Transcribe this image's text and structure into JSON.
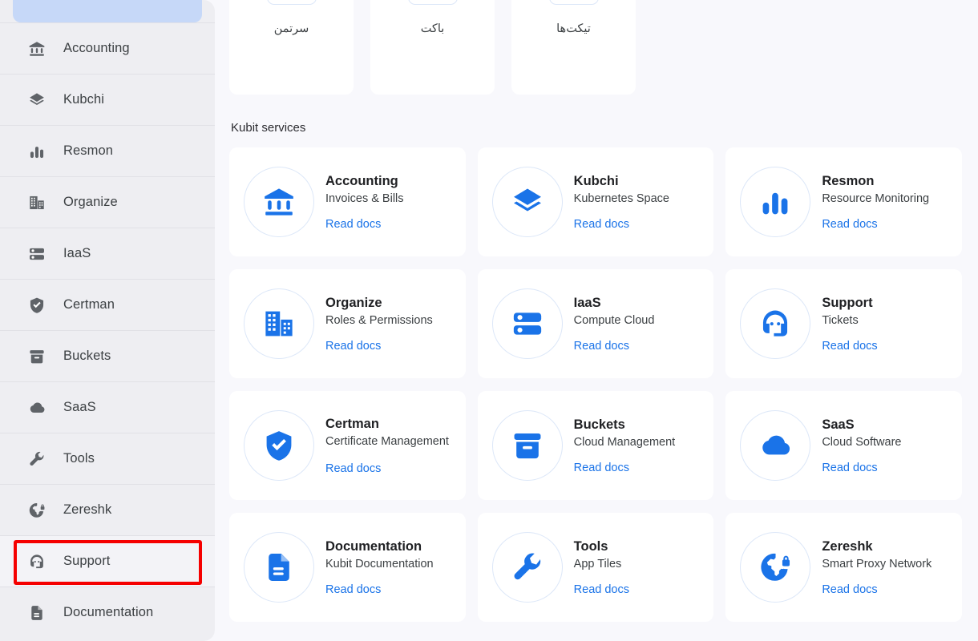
{
  "colors": {
    "accent": "#1a73e8",
    "sidebar_bg": "#eeeef2",
    "page_bg": "#f8f8fc",
    "highlight_box": "#f50000",
    "active_nav": "#c6d8f8"
  },
  "sidebar": {
    "items": [
      {
        "label": "Accounting",
        "icon": "bank-icon"
      },
      {
        "label": "Kubchi",
        "icon": "layers-icon"
      },
      {
        "label": "Resmon",
        "icon": "bar-chart-icon"
      },
      {
        "label": "Organize",
        "icon": "building-icon"
      },
      {
        "label": "IaaS",
        "icon": "server-icon"
      },
      {
        "label": "Certman",
        "icon": "shield-check-icon"
      },
      {
        "label": "Buckets",
        "icon": "archive-icon"
      },
      {
        "label": "SaaS",
        "icon": "cloud-icon"
      },
      {
        "label": "Tools",
        "icon": "wrench-icon"
      },
      {
        "label": "Zereshk",
        "icon": "globe-lock-icon"
      },
      {
        "label": "Support",
        "icon": "headset-icon"
      },
      {
        "label": "Documentation",
        "icon": "document-icon"
      }
    ],
    "highlighted_item": "Support"
  },
  "quick_tiles": [
    {
      "label": "سرتمن",
      "icon": "shield-check-icon"
    },
    {
      "label": "باکت",
      "icon": "archive-icon"
    },
    {
      "label": "تیکت‌ها",
      "icon": "headset-icon"
    }
  ],
  "main": {
    "section_title": "Kubit services",
    "read_docs_label": "Read docs",
    "services": [
      {
        "title": "Accounting",
        "subtitle": "Invoices & Bills",
        "icon": "bank-icon",
        "link": "Read docs"
      },
      {
        "title": "Kubchi",
        "subtitle": "Kubernetes Space",
        "icon": "layers-icon",
        "link": "Read docs"
      },
      {
        "title": "Resmon",
        "subtitle": "Resource Monitoring",
        "icon": "bar-chart-icon",
        "link": "Read docs"
      },
      {
        "title": "Organize",
        "subtitle": "Roles & Permissions",
        "icon": "building-icon",
        "link": "Read docs"
      },
      {
        "title": "IaaS",
        "subtitle": "Compute Cloud",
        "icon": "server-icon",
        "link": "Read docs"
      },
      {
        "title": "Support",
        "subtitle": "Tickets",
        "icon": "headset-icon",
        "link": "Read docs"
      },
      {
        "title": "Certman",
        "subtitle": "Certificate Management",
        "icon": "shield-check-icon",
        "link": "Read docs"
      },
      {
        "title": "Buckets",
        "subtitle": "Cloud Management",
        "icon": "archive-icon",
        "link": "Read docs"
      },
      {
        "title": "SaaS",
        "subtitle": "Cloud Software",
        "icon": "cloud-icon",
        "link": "Read docs"
      },
      {
        "title": "Documentation",
        "subtitle": "Kubit Documentation",
        "icon": "document-icon",
        "link": "Read docs"
      },
      {
        "title": "Tools",
        "subtitle": "App Tiles",
        "icon": "wrench-icon",
        "link": "Read docs"
      },
      {
        "title": "Zereshk",
        "subtitle": "Smart Proxy Network",
        "icon": "globe-lock-icon",
        "link": "Read docs"
      }
    ]
  }
}
